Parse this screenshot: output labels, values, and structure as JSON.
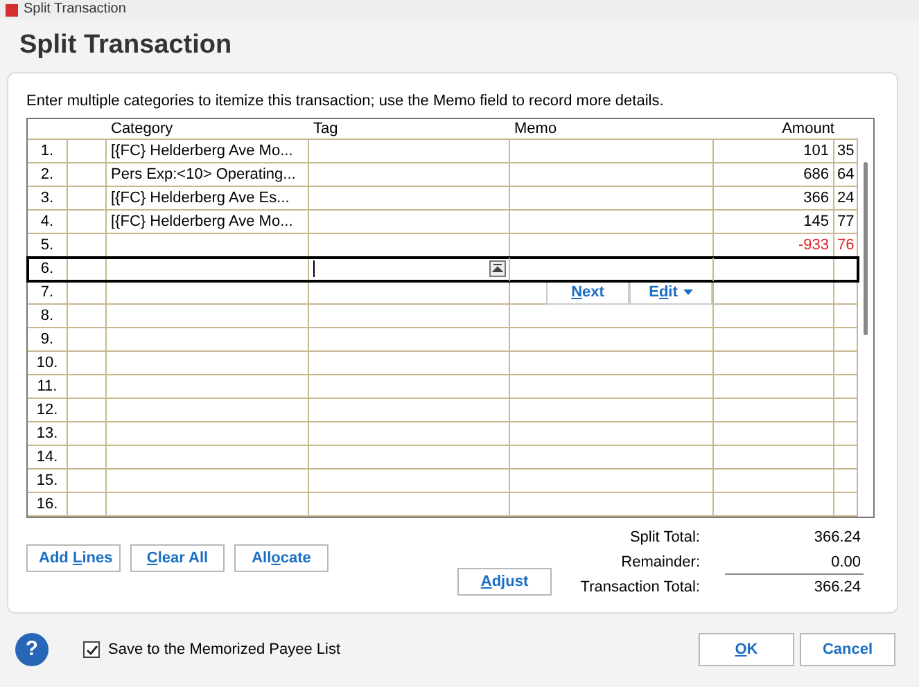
{
  "window": {
    "title": "Split Transaction"
  },
  "heading": "Split Transaction",
  "instructions": "Enter multiple categories to itemize this transaction; use the Memo field to record more details.",
  "table": {
    "columns": [
      "Category",
      "Tag",
      "Memo",
      "Amount"
    ],
    "rows": [
      {
        "number": "1.",
        "category": "[{FC} Helderberg Ave Mo...",
        "dollars": "101",
        "cents": "35",
        "kind": "normal",
        "selected": false
      },
      {
        "number": "2.",
        "category": "Pers Exp:<10> Operating...",
        "dollars": "686",
        "cents": "64",
        "kind": "normal",
        "selected": false
      },
      {
        "number": "3.",
        "category": "[{FC} Helderberg Ave Es...",
        "dollars": "366",
        "cents": "24",
        "kind": "normal",
        "selected": false
      },
      {
        "number": "4.",
        "category": "[{FC} Helderberg Ave Mo...",
        "dollars": "145",
        "cents": "77",
        "kind": "normal",
        "selected": false
      },
      {
        "number": "5.",
        "dollars": "-933",
        "cents": "76",
        "kind": "remainder",
        "selected": false
      },
      {
        "number": "6.",
        "kind": "normal",
        "selected": true
      },
      {
        "number": "7.",
        "kind": "actions",
        "selected": false
      },
      {
        "number": "8.",
        "kind": "normal",
        "selected": false
      },
      {
        "number": "9.",
        "kind": "normal",
        "selected": false
      },
      {
        "number": "10.",
        "kind": "normal",
        "selected": false
      },
      {
        "number": "11.",
        "kind": "normal",
        "selected": false
      },
      {
        "number": "12.",
        "kind": "normal",
        "selected": false
      },
      {
        "number": "13.",
        "kind": "normal",
        "selected": false
      },
      {
        "number": "14.",
        "kind": "normal",
        "selected": false
      },
      {
        "number": "15.",
        "kind": "normal",
        "selected": false
      },
      {
        "number": "16.",
        "kind": "normal",
        "selected": false
      }
    ],
    "row_actions": [
      {
        "label": {
          "key": "N",
          "post": "ext"
        },
        "caret": false
      },
      {
        "label": {
          "pre": "E",
          "key": "d",
          "post": "it"
        },
        "caret": true
      }
    ]
  },
  "left_buttons": [
    {
      "label": {
        "pre": "Add ",
        "key": "L",
        "post": "ines"
      }
    },
    {
      "label": {
        "key": "C",
        "post": "lear All"
      }
    },
    {
      "label": {
        "pre": "All",
        "key": "o",
        "post": "cate"
      }
    }
  ],
  "adjust_button": {
    "label": {
      "key": "A",
      "post": "djust"
    }
  },
  "totals": [
    {
      "label": "Split Total:",
      "value": "366.24",
      "rule": false
    },
    {
      "label": "Remainder:",
      "value": "0.00",
      "rule": true
    },
    {
      "label": "Transaction Total:",
      "value": "366.24",
      "rule": false
    }
  ],
  "help_button": {
    "label": "?"
  },
  "memorize": {
    "label": "Save to the Memorized Payee List",
    "checked": true
  },
  "ok_button": {
    "label": {
      "key": "O",
      "post": "K"
    }
  },
  "cancel_button": {
    "label": {
      "pre": "Cancel"
    }
  }
}
